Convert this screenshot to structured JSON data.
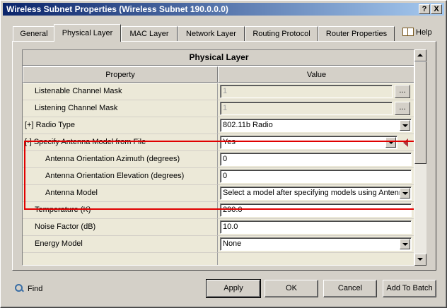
{
  "window": {
    "title": "Wireless Subnet Properties (Wireless Subnet 190.0.0.0)",
    "help_button": "?",
    "close_button": "X"
  },
  "tabs": [
    {
      "label": "General",
      "active": false
    },
    {
      "label": "Physical Layer",
      "active": true
    },
    {
      "label": "MAC Layer",
      "active": false
    },
    {
      "label": "Network Layer",
      "active": false
    },
    {
      "label": "Routing Protocol",
      "active": false
    },
    {
      "label": "Router Properties",
      "active": false
    }
  ],
  "help_label": "Help",
  "grid": {
    "title": "Physical Layer",
    "columns": [
      "Property",
      "Value"
    ],
    "rows": [
      {
        "property": "Listenable Channel Mask",
        "value": "1",
        "kind": "text-ellipsis",
        "disabled": true
      },
      {
        "property": "Listening Channel Mask",
        "value": "1",
        "kind": "text-ellipsis",
        "disabled": true
      },
      {
        "property": "[+] Radio Type",
        "value": "802.11b Radio",
        "kind": "dropdown"
      },
      {
        "property": "[-] Specify Antenna Model from File",
        "value": "Yes",
        "kind": "dropdown",
        "highlighted": true
      },
      {
        "property": "Antenna Orientation Azimuth (degrees)",
        "value": "0",
        "kind": "text",
        "highlighted": true
      },
      {
        "property": "Antenna Orientation Elevation (degrees)",
        "value": "0",
        "kind": "text",
        "highlighted": true
      },
      {
        "property": "Antenna Model",
        "value": "Select a model after specifying models using Antenna",
        "kind": "dropdown",
        "highlighted": true
      },
      {
        "property": "Temperature (K)",
        "value": "290.0",
        "kind": "text"
      },
      {
        "property": "Noise Factor (dB)",
        "value": "10.0",
        "kind": "text"
      },
      {
        "property": "Energy Model",
        "value": "None",
        "kind": "dropdown"
      }
    ],
    "ellipsis_label": "..."
  },
  "footer": {
    "find_label": "Find",
    "buttons": {
      "apply": "Apply",
      "ok": "OK",
      "cancel": "Cancel",
      "add_to_batch": "Add To Batch"
    }
  },
  "colors": {
    "highlight": "#e00000",
    "titlebar_start": "#0a246a",
    "titlebar_end": "#a6caf0"
  },
  "icons": {
    "help": "book-icon",
    "find": "magnifier-icon",
    "collapse": "triangle-left-icon"
  }
}
